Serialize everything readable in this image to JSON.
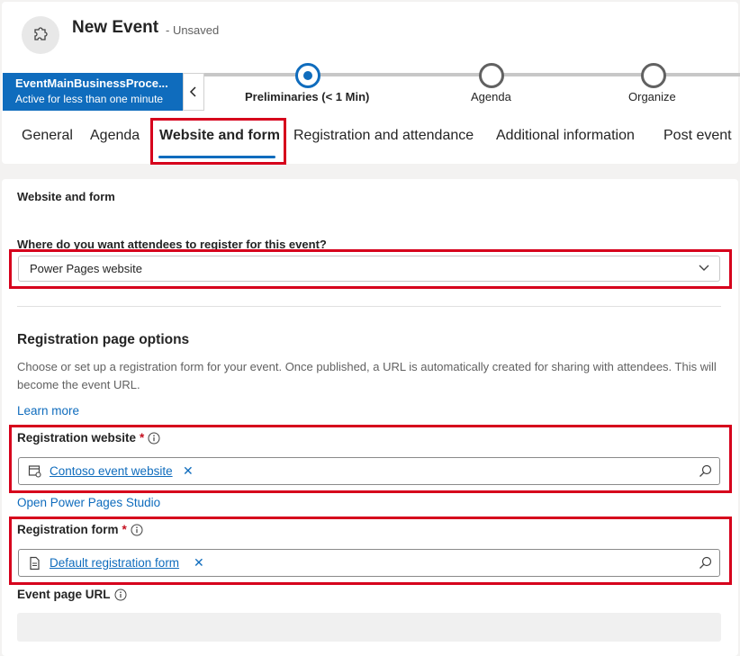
{
  "header": {
    "title": "New Event",
    "status": "- Unsaved",
    "entity_icon": "puzzle-icon"
  },
  "bpf": {
    "active_stage_name": "EventMainBusinessProce...",
    "active_stage_status": "Active for less than one minute",
    "stages": [
      {
        "label": "Preliminaries  (< 1 Min)",
        "state": "active"
      },
      {
        "label": "Agenda",
        "state": "idle"
      },
      {
        "label": "Organize",
        "state": "idle"
      }
    ]
  },
  "tabs": [
    {
      "label": "General"
    },
    {
      "label": "Agenda"
    },
    {
      "label": "Website and form",
      "selected": true
    },
    {
      "label": "Registration and attendance"
    },
    {
      "label": "Additional information"
    },
    {
      "label": "Post event"
    }
  ],
  "section": {
    "title": "Website and form",
    "question": "Where do you want attendees to register for this event?",
    "location_value": "Power Pages website"
  },
  "registration": {
    "heading": "Registration page options",
    "description": "Choose or set up a registration form for your event. Once published, a URL is automatically created for sharing with attendees. This will become the event URL.",
    "learn_more": "Learn more",
    "website_label": "Registration website",
    "website_required": "*",
    "website_value": "Contoso event website",
    "open_studio": "Open Power Pages Studio",
    "form_label": "Registration form",
    "form_required": "*",
    "form_value": "Default registration form",
    "url_label": "Event page URL",
    "url_value": ""
  },
  "colors": {
    "accent": "#0f6cbd",
    "highlight": "#d6001c",
    "required": "#c50f1f"
  }
}
